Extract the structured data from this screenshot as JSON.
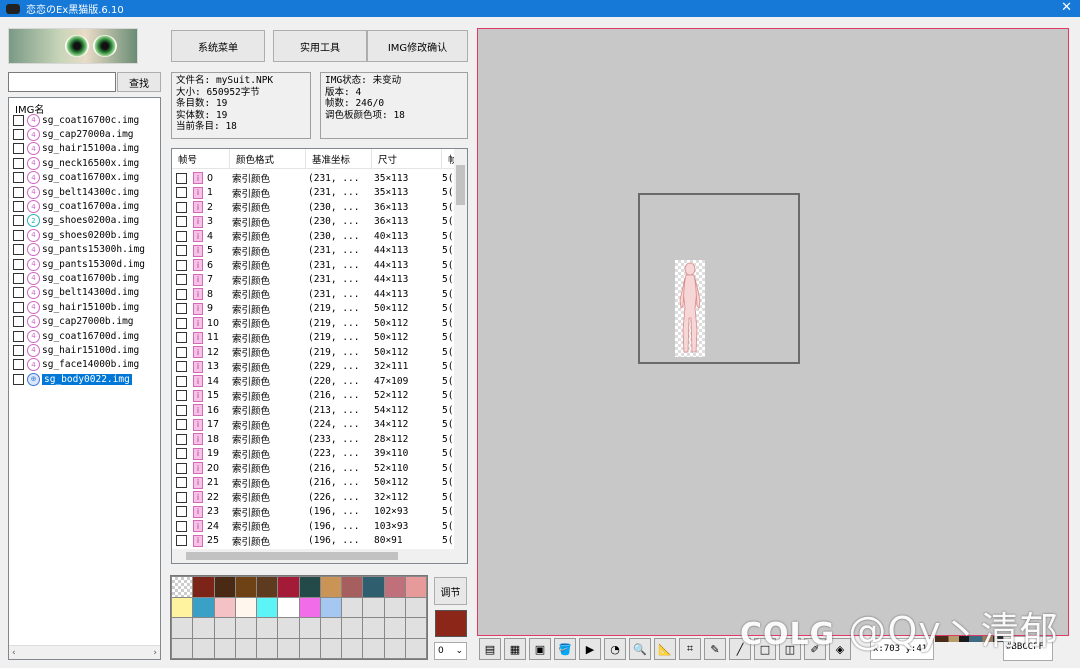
{
  "window": {
    "title": "恋恋のEx黑猫版.6.10",
    "close_glyph": "✕"
  },
  "search": {
    "value": "",
    "button_label": "查找"
  },
  "img_list": {
    "header": "IMG名",
    "items": [
      {
        "name": "sg_coat16700c.img",
        "icon": "img-icon-pink"
      },
      {
        "name": "sg_cap27000a.img",
        "icon": "img-icon-pink"
      },
      {
        "name": "sg_hair15100a.img",
        "icon": "img-icon-pink"
      },
      {
        "name": "sg_neck16500x.img",
        "icon": "img-icon-pink"
      },
      {
        "name": "sg_coat16700x.img",
        "icon": "img-icon-pink"
      },
      {
        "name": "sg_belt14300c.img",
        "icon": "img-icon-pink"
      },
      {
        "name": "sg_coat16700a.img",
        "icon": "img-icon-pink"
      },
      {
        "name": "sg_shoes0200a.img",
        "icon": "img-icon-teal"
      },
      {
        "name": "sg_shoes0200b.img",
        "icon": "img-icon-pink"
      },
      {
        "name": "sg_pants15300h.img",
        "icon": "img-icon-pink"
      },
      {
        "name": "sg_pants15300d.img",
        "icon": "img-icon-pink"
      },
      {
        "name": "sg_coat16700b.img",
        "icon": "img-icon-pink"
      },
      {
        "name": "sg_belt14300d.img",
        "icon": "img-icon-pink"
      },
      {
        "name": "sg_hair15100b.img",
        "icon": "img-icon-pink"
      },
      {
        "name": "sg_cap27000b.img",
        "icon": "img-icon-pink"
      },
      {
        "name": "sg_coat16700d.img",
        "icon": "img-icon-pink"
      },
      {
        "name": "sg_hair15100d.img",
        "icon": "img-icon-pink"
      },
      {
        "name": "sg_face14000b.img",
        "icon": "img-icon-pink"
      },
      {
        "name": "sg_body0022.img",
        "icon": "img-icon-blue",
        "selected": true
      }
    ]
  },
  "menu": {
    "system": "系统菜单",
    "tools": "实用工具",
    "img_confirm": "IMG修改确认"
  },
  "file_info": {
    "filename": "文件名: mySuit.NPK",
    "size": "大小: 650952字节",
    "entries": "条目数: 19",
    "entities": "实体数: 19",
    "current": "当前条目: 18"
  },
  "img_info": {
    "status": "IMG状态: 未变动",
    "version": "版本: 4",
    "frames": "帧数: 246/0",
    "palette": "调色板颜色项: 18"
  },
  "frame_table": {
    "headers": [
      "帧号",
      "颜色格式",
      "基准坐标",
      "尺寸",
      "帧"
    ],
    "rows": [
      {
        "no": "0",
        "fmt": "索引颜色",
        "base": "(231, ...",
        "size": "35×113",
        "extra": "5("
      },
      {
        "no": "1",
        "fmt": "索引颜色",
        "base": "(231, ...",
        "size": "35×113",
        "extra": "5("
      },
      {
        "no": "2",
        "fmt": "索引颜色",
        "base": "(230, ...",
        "size": "36×113",
        "extra": "5("
      },
      {
        "no": "3",
        "fmt": "索引颜色",
        "base": "(230, ...",
        "size": "36×113",
        "extra": "5("
      },
      {
        "no": "4",
        "fmt": "索引颜色",
        "base": "(230, ...",
        "size": "40×113",
        "extra": "5("
      },
      {
        "no": "5",
        "fmt": "索引颜色",
        "base": "(231, ...",
        "size": "44×113",
        "extra": "5("
      },
      {
        "no": "6",
        "fmt": "索引颜色",
        "base": "(231, ...",
        "size": "44×113",
        "extra": "5("
      },
      {
        "no": "7",
        "fmt": "索引颜色",
        "base": "(231, ...",
        "size": "44×113",
        "extra": "5("
      },
      {
        "no": "8",
        "fmt": "索引颜色",
        "base": "(231, ...",
        "size": "44×113",
        "extra": "5("
      },
      {
        "no": "9",
        "fmt": "索引颜色",
        "base": "(219, ...",
        "size": "50×112",
        "extra": "5("
      },
      {
        "no": "10",
        "fmt": "索引颜色",
        "base": "(219, ...",
        "size": "50×112",
        "extra": "5("
      },
      {
        "no": "11",
        "fmt": "索引颜色",
        "base": "(219, ...",
        "size": "50×112",
        "extra": "5("
      },
      {
        "no": "12",
        "fmt": "索引颜色",
        "base": "(219, ...",
        "size": "50×112",
        "extra": "5("
      },
      {
        "no": "13",
        "fmt": "索引颜色",
        "base": "(229, ...",
        "size": "32×111",
        "extra": "5("
      },
      {
        "no": "14",
        "fmt": "索引颜色",
        "base": "(220, ...",
        "size": "47×109",
        "extra": "5("
      },
      {
        "no": "15",
        "fmt": "索引颜色",
        "base": "(216, ...",
        "size": "52×112",
        "extra": "5("
      },
      {
        "no": "16",
        "fmt": "索引颜色",
        "base": "(213, ...",
        "size": "54×112",
        "extra": "5("
      },
      {
        "no": "17",
        "fmt": "索引颜色",
        "base": "(224, ...",
        "size": "34×112",
        "extra": "5("
      },
      {
        "no": "18",
        "fmt": "索引颜色",
        "base": "(233, ...",
        "size": "28×112",
        "extra": "5("
      },
      {
        "no": "19",
        "fmt": "索引颜色",
        "base": "(223, ...",
        "size": "39×110",
        "extra": "5("
      },
      {
        "no": "20",
        "fmt": "索引颜色",
        "base": "(216, ...",
        "size": "52×110",
        "extra": "5("
      },
      {
        "no": "21",
        "fmt": "索引颜色",
        "base": "(216, ...",
        "size": "50×112",
        "extra": "5("
      },
      {
        "no": "22",
        "fmt": "索引颜色",
        "base": "(226, ...",
        "size": "32×112",
        "extra": "5("
      },
      {
        "no": "23",
        "fmt": "索引颜色",
        "base": "(196, ...",
        "size": "102×93",
        "extra": "5("
      },
      {
        "no": "24",
        "fmt": "索引颜色",
        "base": "(196, ...",
        "size": "103×93",
        "extra": "5("
      },
      {
        "no": "25",
        "fmt": "索引颜色",
        "base": "(196, ...",
        "size": "80×91",
        "extra": "5("
      }
    ]
  },
  "palette": {
    "colors": [
      "checker",
      "#7c2417",
      "#4a2a14",
      "#6e4214",
      "#5e3a1e",
      "#a31b36",
      "#234a49",
      "#c99455",
      "#a65e5e",
      "#2f5f6e",
      "#c0707b",
      "#e79a9a",
      "#fff3a0",
      "#3aa0c6",
      "#f4c2c4",
      "#fff6ee",
      "#5cf4f4",
      "#ffffff",
      "#f06ce8",
      "#a4c8f0",
      "#e0e0e0",
      "#e0e0e0",
      "#e0e0e0",
      "#e0e0e0"
    ],
    "empty_cells": 24,
    "adjust_label": "调节",
    "selected_color": "#8c2618",
    "zoom_value": "0"
  },
  "status": {
    "coords": "x:703 y:41",
    "hex": "#BBCCFF"
  },
  "watermark": {
    "logo": "COLG",
    "text": "@Qy丶清郁"
  },
  "tools": [
    "frame-props-icon",
    "color-grid-icon",
    "film-icon",
    "paint-bucket-icon",
    "camera-icon",
    "lips-icon",
    "magnifier-icon",
    "ruler-icon",
    "crop-icon",
    "pencil-icon",
    "line-icon",
    "rect-icon",
    "eraser-icon",
    "dropper-icon",
    "tag-icon"
  ]
}
